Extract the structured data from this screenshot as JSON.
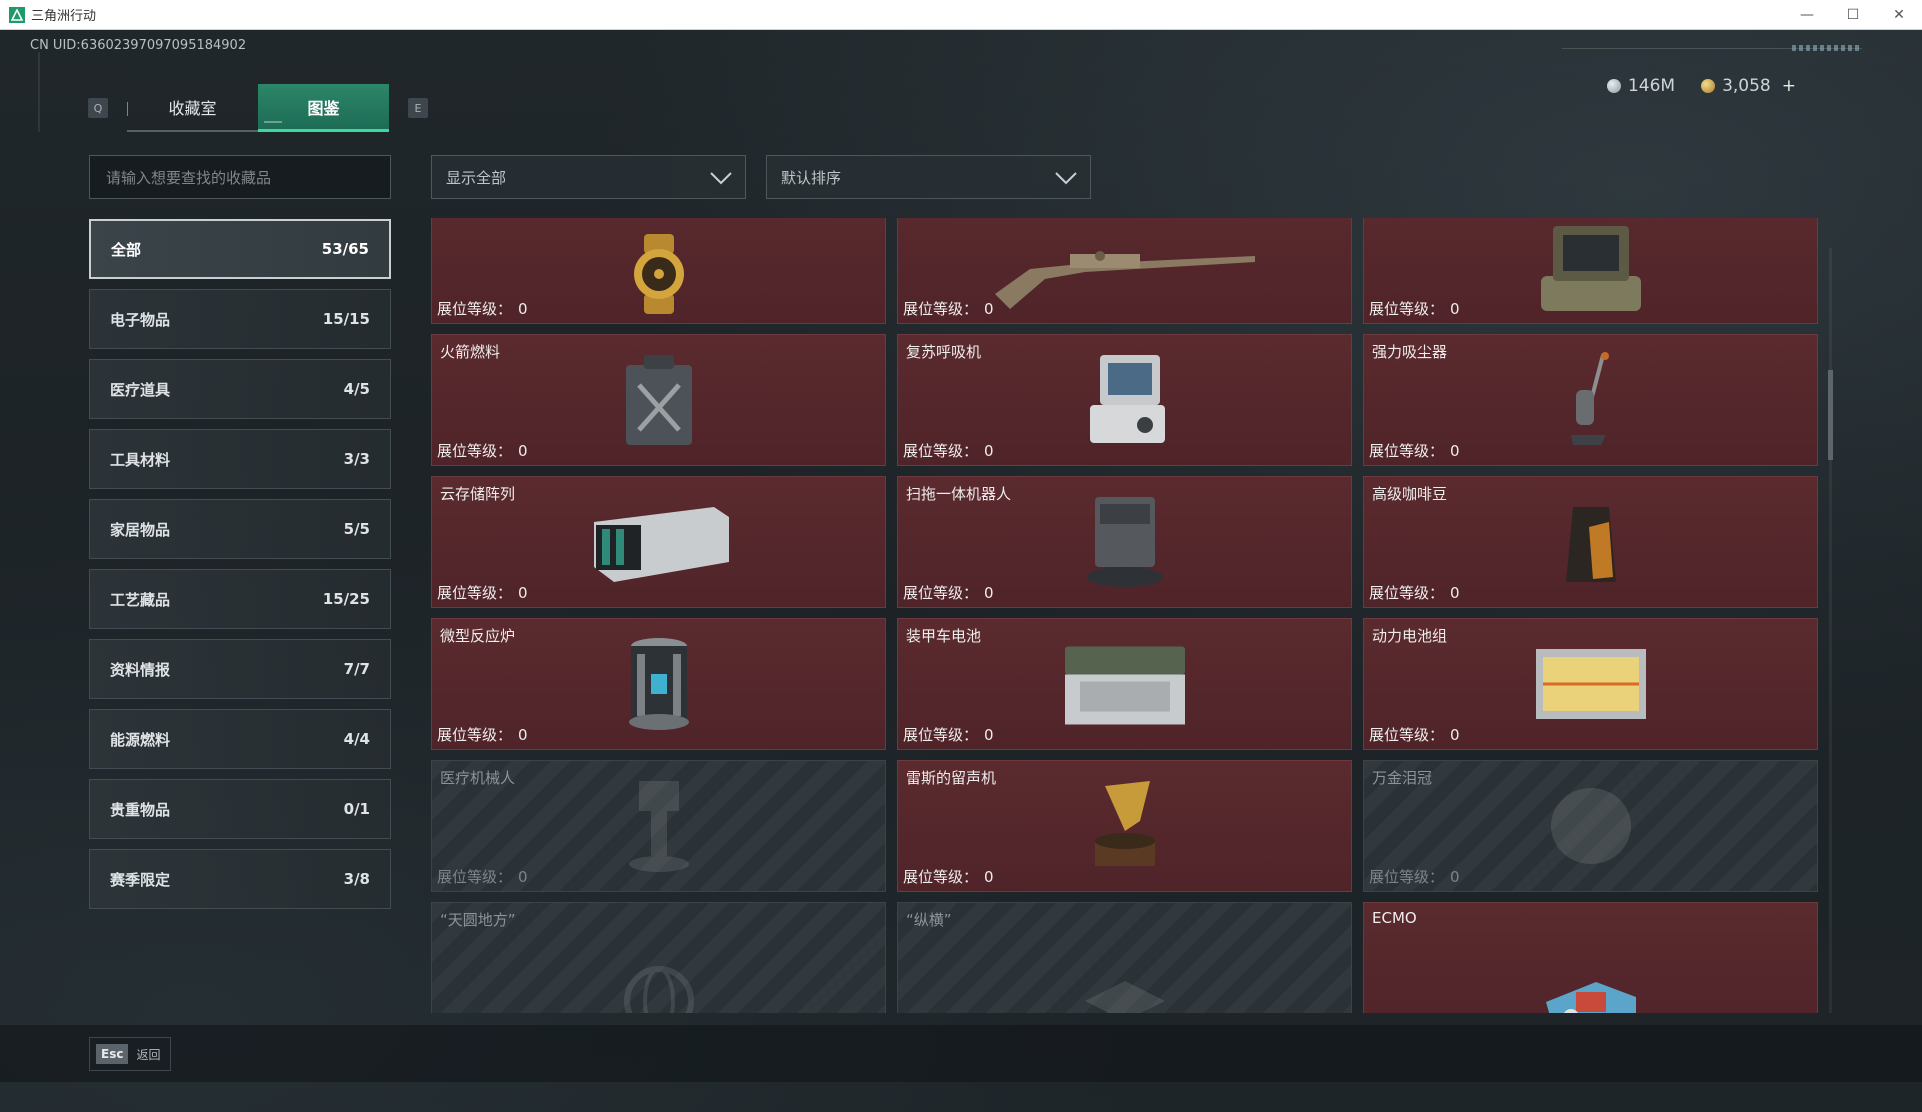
{
  "window": {
    "title": "三角洲行动"
  },
  "uid": "CN UID:636023970970951849­02",
  "keys": {
    "left": "Q",
    "right": "E"
  },
  "tabs": [
    {
      "label": "收藏室",
      "active": false
    },
    {
      "label": "图鉴",
      "active": true
    }
  ],
  "currency": {
    "silver": "146M",
    "gold": "3,058",
    "plus": "+"
  },
  "search": {
    "placeholder": "请输入想要查找的收藏品"
  },
  "filters": {
    "show": "显示全部",
    "sort": "默认排序"
  },
  "categories": [
    {
      "label": "全部",
      "count": "53/65"
    },
    {
      "label": "电子物品",
      "count": "15/15"
    },
    {
      "label": "医疗道具",
      "count": "4/5"
    },
    {
      "label": "工具材料",
      "count": "3/3"
    },
    {
      "label": "家居物品",
      "count": "5/5"
    },
    {
      "label": "工艺藏品",
      "count": "15/25"
    },
    {
      "label": "资料情报",
      "count": "7/7"
    },
    {
      "label": "能源燃料",
      "count": "4/4"
    },
    {
      "label": "贵重物品",
      "count": "0/1"
    },
    {
      "label": "赛季限定",
      "count": "3/8"
    }
  ],
  "level_label": "展位等级：",
  "items": [
    {
      "name": "",
      "level": "0",
      "icon": "gold-watch-icon",
      "locked": false
    },
    {
      "name": "",
      "level": "0",
      "icon": "antique-rifle-icon",
      "locked": false
    },
    {
      "name": "",
      "level": "0",
      "icon": "military-terminal-icon",
      "locked": false
    },
    {
      "name": "火箭燃料",
      "level": "0",
      "icon": "fuel-canister-icon",
      "locked": false
    },
    {
      "name": "复苏呼吸机",
      "level": "0",
      "icon": "ventilator-icon",
      "locked": false
    },
    {
      "name": "强力吸尘器",
      "level": "0",
      "icon": "vacuum-cleaner-icon",
      "locked": false
    },
    {
      "name": "云存储阵列",
      "level": "0",
      "icon": "storage-array-icon",
      "locked": false
    },
    {
      "name": "扫拖一体机器人",
      "level": "0",
      "icon": "mop-robot-icon",
      "locked": false
    },
    {
      "name": "高级咖啡豆",
      "level": "0",
      "icon": "coffee-bag-icon",
      "locked": false
    },
    {
      "name": "微型反应炉",
      "level": "0",
      "icon": "micro-reactor-icon",
      "locked": false
    },
    {
      "name": "装甲车电池",
      "level": "0",
      "icon": "vehicle-battery-icon",
      "locked": false
    },
    {
      "name": "动力电池组",
      "level": "0",
      "icon": "battery-pack-icon",
      "locked": false
    },
    {
      "name": "医疗机械人",
      "level": "0",
      "icon": "medical-robot-icon",
      "locked": true
    },
    {
      "name": "雷斯的留声机",
      "level": "0",
      "icon": "gramophone-icon",
      "locked": false
    },
    {
      "name": "万金泪冠",
      "level": "0",
      "icon": "crown-icon",
      "locked": true
    },
    {
      "name": "“天圆地方”",
      "level": "",
      "icon": "globe-icon",
      "locked": true
    },
    {
      "name": "“纵横”",
      "level": "",
      "icon": "chessboard-icon",
      "locked": true
    },
    {
      "name": "ECMO",
      "level": "",
      "icon": "ecmo-machine-icon",
      "locked": false
    }
  ],
  "back": {
    "key": "Esc",
    "label": "返回"
  },
  "colors": {
    "accent": "#2c8668",
    "card_unlocked": "#5a2a2e",
    "card_locked": "#2a3237"
  }
}
